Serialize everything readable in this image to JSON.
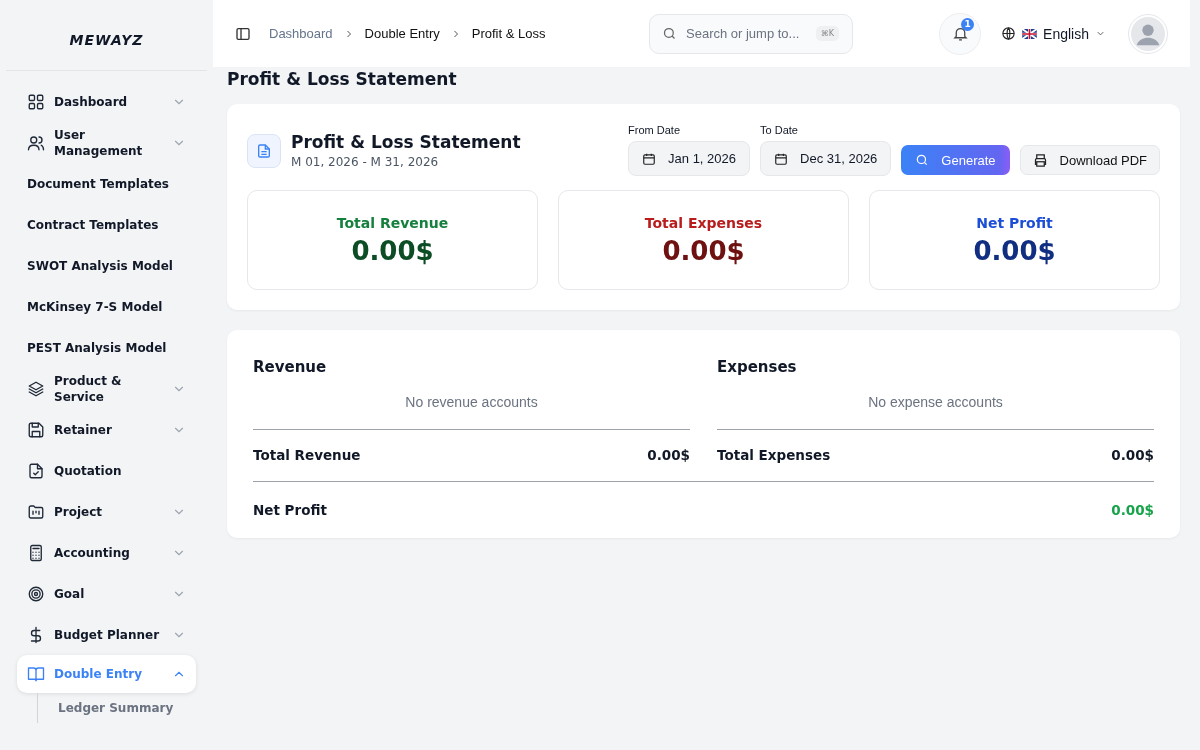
{
  "logo": "MEWAYZ",
  "sidebar": {
    "items": [
      {
        "label": "Dashboard",
        "kind": "group",
        "expanded": false,
        "selected": false
      },
      {
        "label": "User Management",
        "kind": "group",
        "expanded": false,
        "selected": false
      },
      {
        "label": "Document Templates",
        "kind": "plain"
      },
      {
        "label": "Contract Templates",
        "kind": "plain"
      },
      {
        "label": "SWOT Analysis Model",
        "kind": "plain"
      },
      {
        "label": "McKinsey 7-S Model",
        "kind": "plain"
      },
      {
        "label": "PEST Analysis Model",
        "kind": "plain"
      },
      {
        "label": "Product & Service",
        "kind": "group",
        "expanded": false,
        "selected": false
      },
      {
        "label": "Retainer",
        "kind": "group",
        "expanded": false,
        "selected": false
      },
      {
        "label": "Quotation",
        "kind": "link",
        "selected": false
      },
      {
        "label": "Project",
        "kind": "group",
        "expanded": false,
        "selected": false
      },
      {
        "label": "Accounting",
        "kind": "group",
        "expanded": false,
        "selected": false
      },
      {
        "label": "Goal",
        "kind": "group",
        "expanded": false,
        "selected": false
      },
      {
        "label": "Budget Planner",
        "kind": "group",
        "expanded": false,
        "selected": false
      },
      {
        "label": "Double Entry",
        "kind": "group",
        "expanded": true,
        "selected": true,
        "children": [
          {
            "label": "Ledger Summary"
          }
        ]
      }
    ]
  },
  "breadcrumbs": [
    "Dashboard",
    "Double Entry",
    "Profit & Loss"
  ],
  "search": {
    "placeholder": "Search or jump to...",
    "shortcut": "⌘K"
  },
  "notifications": {
    "count": "1"
  },
  "language": "English",
  "page_title": "Profit & Loss Statement",
  "report": {
    "title": "Profit & Loss Statement",
    "period": "M 01, 2026 - M 31, 2026",
    "from_date": {
      "label": "From Date",
      "value": "Jan 1, 2026"
    },
    "to_date": {
      "label": "To Date",
      "value": "Dec 31, 2026"
    },
    "buttons": [
      "Generate",
      "Download PDF"
    ],
    "summary": [
      {
        "title": "Total Revenue",
        "value": "0.00$",
        "color": "#15803d"
      },
      {
        "title": "Total Expenses",
        "value": "0.00$",
        "color": "#b91c1c"
      },
      {
        "title": "Net Profit",
        "value": "0.00$",
        "color": "#1d4ed8"
      }
    ]
  },
  "sections": [
    {
      "title": "Revenue",
      "empty": "No revenue accounts",
      "total_label": "Total Revenue",
      "total": "0.00$"
    },
    {
      "title": "Expenses",
      "empty": "No expense accounts",
      "total_label": "Total Expenses",
      "total": "0.00$"
    }
  ],
  "net_profit": {
    "label": "Net Profit",
    "value": "0.00$"
  }
}
